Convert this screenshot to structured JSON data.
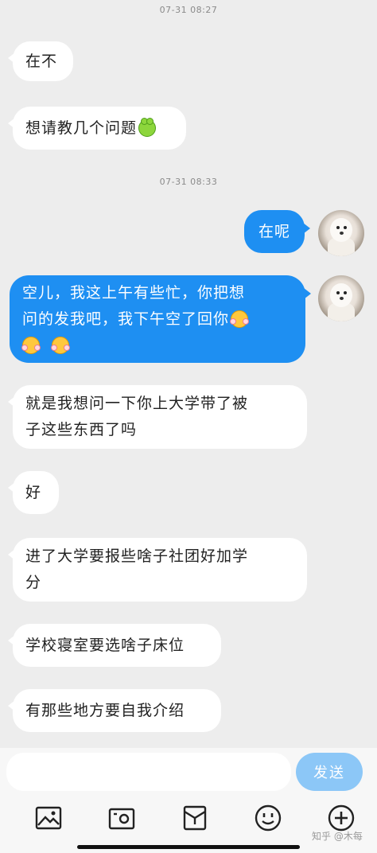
{
  "timestamps": [
    "07-31 08:27",
    "07-31 08:33"
  ],
  "messages": {
    "m1": "在不",
    "m2": "想请教几个问题",
    "m3": "在呢",
    "m4_line1": "空儿，我这上午有些忙，你把想",
    "m4_line2": "问的发我吧，我下午空了回你",
    "m5_line1": "就是我想问一下你上大学带了被",
    "m5_line2": "子这些东西了吗",
    "m6": "好",
    "m7_line1": "进了大学要报些啥子社团好加学",
    "m7_line2": "分",
    "m8": "学校寝室要选啥子床位",
    "m9": "有那些地方要自我介绍"
  },
  "emojis": {
    "m2": "frog-emoji",
    "m4": [
      "blush-emoji",
      "blush-emoji",
      "blush-emoji"
    ]
  },
  "input": {
    "value": "",
    "placeholder": ""
  },
  "send_label": "发送",
  "toolbar": [
    "image-icon",
    "camera-icon",
    "red-packet-icon",
    "emoji-icon",
    "plus-icon"
  ],
  "watermark": "知乎 @木每",
  "colors": {
    "background": "#ededed",
    "incoming_bubble": "#ffffff",
    "outgoing_bubble": "#1e8ff2",
    "send_button": "#8cc7f7",
    "timestamp": "#8a8a8a"
  }
}
